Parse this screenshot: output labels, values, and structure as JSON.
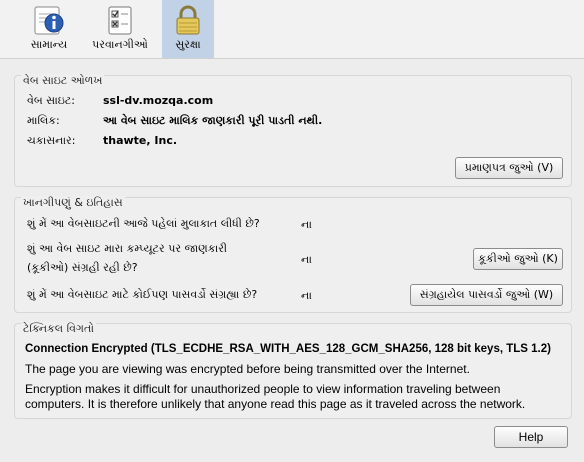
{
  "tabs": [
    {
      "label": "સામાન્ય",
      "icon": "info-icon"
    },
    {
      "label": "પરવાનગીઓ",
      "icon": "permissions-icon"
    },
    {
      "label": "સુરક્ષા",
      "icon": "lock-icon"
    }
  ],
  "identity": {
    "title": "વેબ સાઇટ ઓળખ",
    "website_label": "વેબ સાઇટ:",
    "website_value": "ssl-dv.mozqa.com",
    "owner_label": "માલિક:",
    "owner_value": "આ વેબ સાઇટ માલિક જાણકારી પૂરી પાડતી નથી.",
    "verifier_label": "ચકાસનાર:",
    "verifier_value": "thawte, Inc.",
    "view_cert_button": "પ્રમાણપત્ર જુઓ (V)"
  },
  "privacy": {
    "title": "ખાનગીપણું & ઇતિહાસ",
    "q1": "શું મેં આ વેબસાઇટની આજે પહેલાં મુલાકાત લીધી છે?",
    "a1": "ના",
    "q2_line1": "શું આ વેબ સાઇટ મારા કમ્પ્યૂટર પર જાણકારી",
    "q2_line2": "(કૂકીઓ) સંગ્રહી રહી છે?",
    "a2": "ના",
    "cookies_button": "કૂકીઓ જુઓ (K)",
    "q3": "શું મેં આ વેબસાઇટ માટે કોઈપણ પાસવર્ડો સંગ્રહ્યા છે?",
    "a3": "ના",
    "passwords_button": "સંગ્રહાયેલ પાસવર્ડો જુઓ (W)"
  },
  "technical": {
    "title": "ટેક્નિકલ વિગતો",
    "connection": "Connection Encrypted (TLS_ECDHE_RSA_WITH_AES_128_GCM_SHA256, 128 bit keys, TLS 1.2)",
    "line1": "The page you are viewing was encrypted before being transmitted over the Internet.",
    "line2a": "Encryption makes it difficult for unauthorized people to view information traveling between",
    "line2b": "computers. It is therefore unlikely that anyone read this page as it traveled across the network."
  },
  "help_button": "Help"
}
